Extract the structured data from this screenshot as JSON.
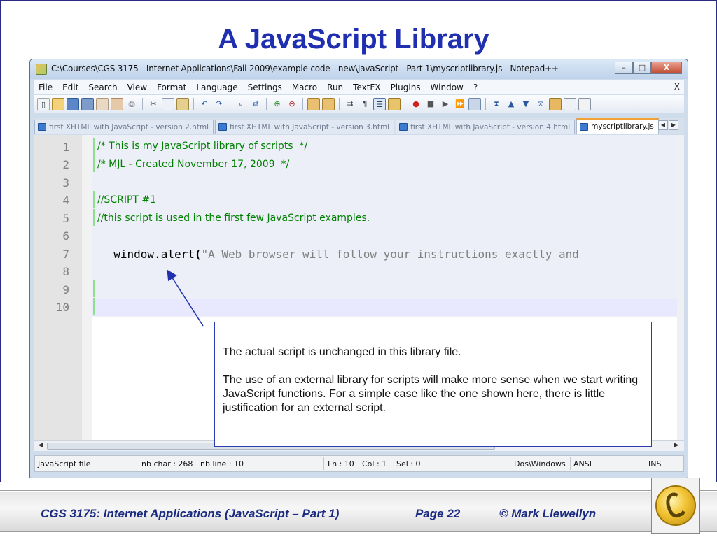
{
  "slide": {
    "title": "A JavaScript Library"
  },
  "window": {
    "title": "C:\\Courses\\CGS 3175 - Internet Applications\\Fall 2009\\example code - new\\JavaScript - Part 1\\myscriptlibrary.js - Notepad++",
    "buttons": {
      "minimize": "–",
      "maximize": "□",
      "close": "X"
    }
  },
  "menubar": {
    "items": [
      "File",
      "Edit",
      "Search",
      "View",
      "Format",
      "Language",
      "Settings",
      "Macro",
      "Run",
      "TextFX",
      "Plugins",
      "Window",
      "?"
    ],
    "close": "X"
  },
  "tabs": [
    {
      "label": "first XHTML with JavaScript - version 2.html",
      "active": false
    },
    {
      "label": "first XHTML with JavaScript - version 3.html",
      "active": false
    },
    {
      "label": "first XHTML with JavaScript - version 4.html",
      "active": false
    },
    {
      "label": "myscriptlibrary.js",
      "active": true
    }
  ],
  "editor": {
    "line_numbers": [
      "1",
      "2",
      "3",
      "4",
      "5",
      "6",
      "7",
      "8",
      "9",
      "10"
    ],
    "lines": [
      "/* This is my JavaScript library of scripts  */",
      "/* MJL - Created November 17, 2009  */",
      "",
      "//SCRIPT #1",
      "//this script is used in the first few JavaScript examples.",
      "",
      "",
      "",
      "",
      ""
    ],
    "line7": {
      "call": "  window.alert",
      "paren": "(",
      "string": "\"A Web browser will follow your instructions exactly and"
    }
  },
  "statusbar": {
    "file_type": "JavaScript file",
    "nb_char": "nb char : 268",
    "nb_line": "nb line : 10",
    "ln": "Ln : 10",
    "col": "Col : 1",
    "sel": "Sel : 0",
    "eol": "Dos\\Windows",
    "encoding": "ANSI",
    "mode": "INS"
  },
  "callout": {
    "paragraph1": "The actual script is unchanged in this library file.",
    "paragraph2": "The use of an external library for scripts will make more sense when we start writing JavaScript functions.  For a simple case like the one shown here, there is little justification for an external script."
  },
  "footer": {
    "course": "CGS 3175: Internet Applications (JavaScript – Part 1)",
    "page": "Page 22",
    "author": "© Mark Llewellyn"
  },
  "colors": {
    "title": "#1f2fb0",
    "comment": "#008000",
    "string": "#808080",
    "footer_text": "#1a2a80",
    "callout_border": "#2b3bb0"
  }
}
